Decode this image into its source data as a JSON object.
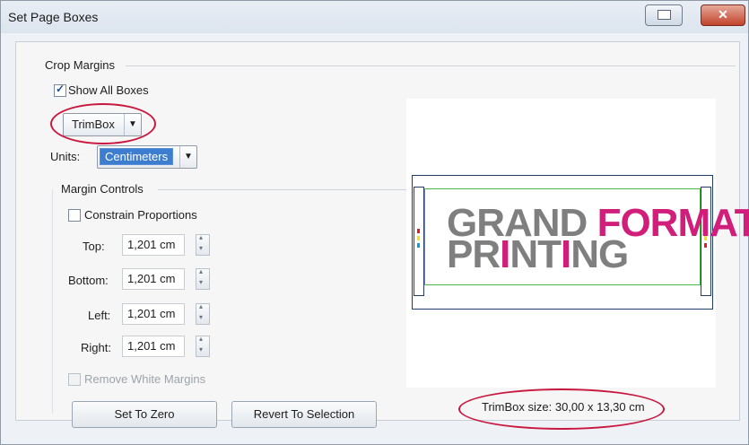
{
  "window": {
    "title": "Set Page Boxes",
    "close_glyph": "✕"
  },
  "crop": {
    "group_title": "Crop Margins",
    "show_all_label": "Show All Boxes",
    "box_select": "TrimBox",
    "units_label": "Units:",
    "units_value": "Centimeters"
  },
  "margin_controls": {
    "title": "Margin Controls",
    "constrain_label": "Constrain Proportions",
    "top_label": "Top:",
    "top_value": "1,201 cm",
    "bottom_label": "Bottom:",
    "bottom_value": "1,201 cm",
    "left_label": "Left:",
    "left_value": "1,201 cm",
    "right_label": "Right:",
    "right_value": "1,201 cm",
    "remove_white_label": "Remove White Margins"
  },
  "buttons": {
    "set_to_zero": "Set To Zero",
    "revert": "Revert To Selection"
  },
  "preview": {
    "line1_gray": "GRAND ",
    "line1_accent": "FORMAT",
    "line2_a": "PR",
    "line2_accent": "I",
    "line2_b": "NT",
    "line2_accent2": "I",
    "line2_c": "NG",
    "size_label": "TrimBox size: 30,00 x 13,30 cm"
  },
  "colors": {
    "accent_pink": "#d11e7b",
    "highlight_ellipse": "#c9183f",
    "selection_blue": "#3d7dd0"
  }
}
